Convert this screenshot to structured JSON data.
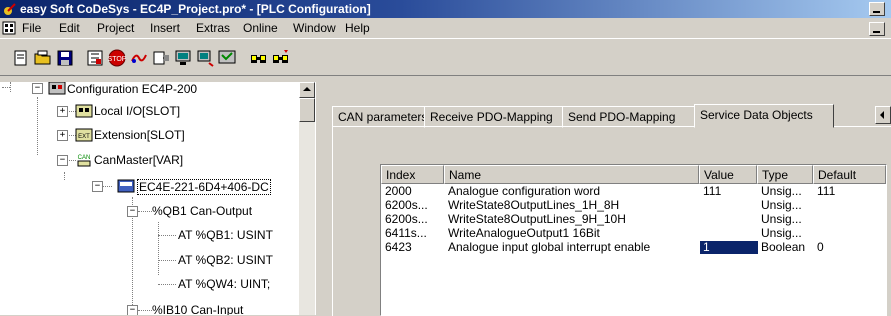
{
  "window": {
    "title": "easy Soft CoDeSys - EC4P_Project.pro* - [PLC Configuration]"
  },
  "menu": [
    "File",
    "Edit",
    "Project",
    "Insert",
    "Extras",
    "Online",
    "Window",
    "Help"
  ],
  "toolbar_icons": [
    "new-icon",
    "open-icon",
    "save-icon",
    "build-icon",
    "stop-icon",
    "run-icon",
    "step-icon",
    "login-icon",
    "logout-icon",
    "monitor-icon",
    "find-icon",
    "replace-icon"
  ],
  "tree": {
    "root": "Configuration EC4P-200",
    "local_io": "Local I/O[SLOT]",
    "extension": "Extension[SLOT]",
    "canmaster": "CanMaster[VAR]",
    "module": "EC4E-221-6D4+406-DC",
    "qb1": "%QB1 Can-Output",
    "at_qb1": "AT %QB1: USINT",
    "at_qb2": "AT %QB2: USINT",
    "at_qw4": "AT %QW4: UINT;",
    "ib10": "%IB10 Can-Input"
  },
  "tabs": [
    "CAN parameters",
    "Receive PDO-Mapping",
    "Send PDO-Mapping",
    "Service Data Objects"
  ],
  "active_tab": "Service Data Objects",
  "table": {
    "headers": [
      "Index",
      "Name",
      "Value",
      "Type",
      "Default"
    ],
    "rows": [
      {
        "index": "2000",
        "name": "Analogue configuration word",
        "value": "111",
        "type": "Unsig...",
        "default": "111"
      },
      {
        "index": "6200s...",
        "name": "WriteState8OutputLines_1H_8H",
        "value": "",
        "type": "Unsig...",
        "default": ""
      },
      {
        "index": "6200s...",
        "name": "WriteState8OutputLines_9H_10H",
        "value": "",
        "type": "Unsig...",
        "default": ""
      },
      {
        "index": "6411s...",
        "name": "WriteAnalogueOutput1 16Bit",
        "value": "",
        "type": "Unsig...",
        "default": ""
      },
      {
        "index": "6423",
        "name": "Analogue input global interrupt enable",
        "value": "1",
        "type": "Boolean",
        "default": "0"
      }
    ]
  },
  "colors": {
    "title_start": "#0a246a",
    "title_end": "#a6caf0",
    "selection": "#0a246a",
    "face": "#d4d0c8"
  }
}
